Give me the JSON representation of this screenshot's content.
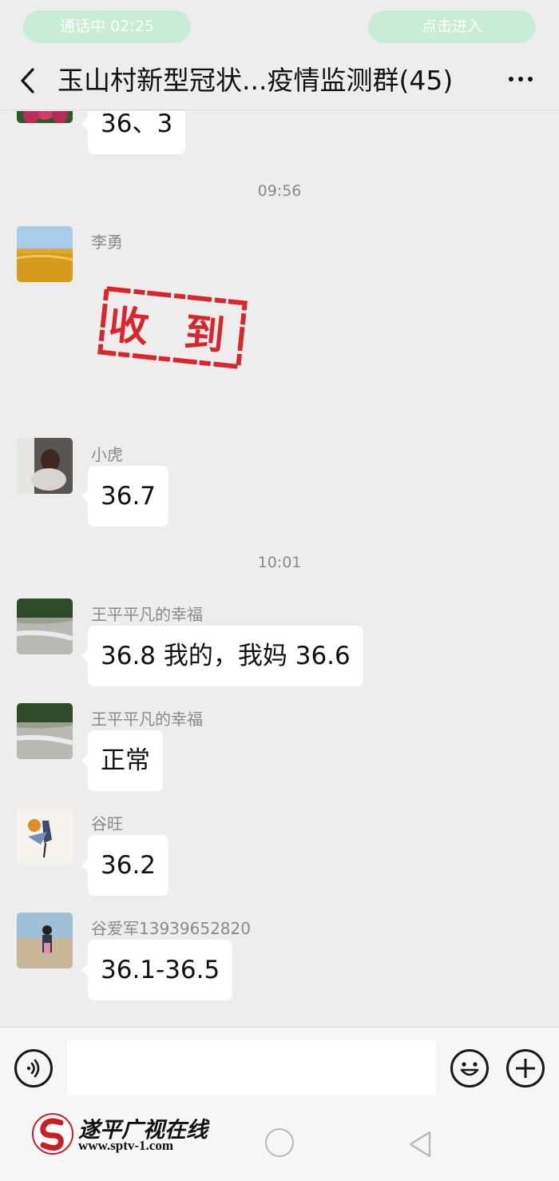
{
  "status_bar": {
    "call_label": "通话中   02:25",
    "enter_label": "点击进入"
  },
  "header": {
    "title": "玉山村新型冠状...疫情监测群(45)",
    "more_label": "···"
  },
  "chat": {
    "first_bubble_text": "36、3",
    "time_1": "09:56",
    "time_2": "10:01",
    "messages": [
      {
        "sender": "李勇",
        "content": "收 到"
      },
      {
        "sender": "小虎",
        "content": "36.7"
      },
      {
        "sender": "王平平凡的幸福",
        "content": "36.8 我的，我妈 36.6"
      },
      {
        "sender": "王平平凡的幸福",
        "content": "正常"
      },
      {
        "sender": "谷旺",
        "content": "36.2"
      },
      {
        "sender": "谷爱军13939652820",
        "content": "36.1-36.5"
      }
    ]
  },
  "input_bar": {
    "voice_icon": "voice-icon",
    "emoji_icon": "emoji-icon",
    "plus_icon": "plus-icon"
  },
  "watermark": {
    "name": "遂平广视在线",
    "url": "www.sptv-1.com"
  },
  "colors": {
    "background": "#ededed",
    "pill": "#c8ecd6",
    "bubble": "#ffffff",
    "stamp_red": "#d8262c"
  }
}
